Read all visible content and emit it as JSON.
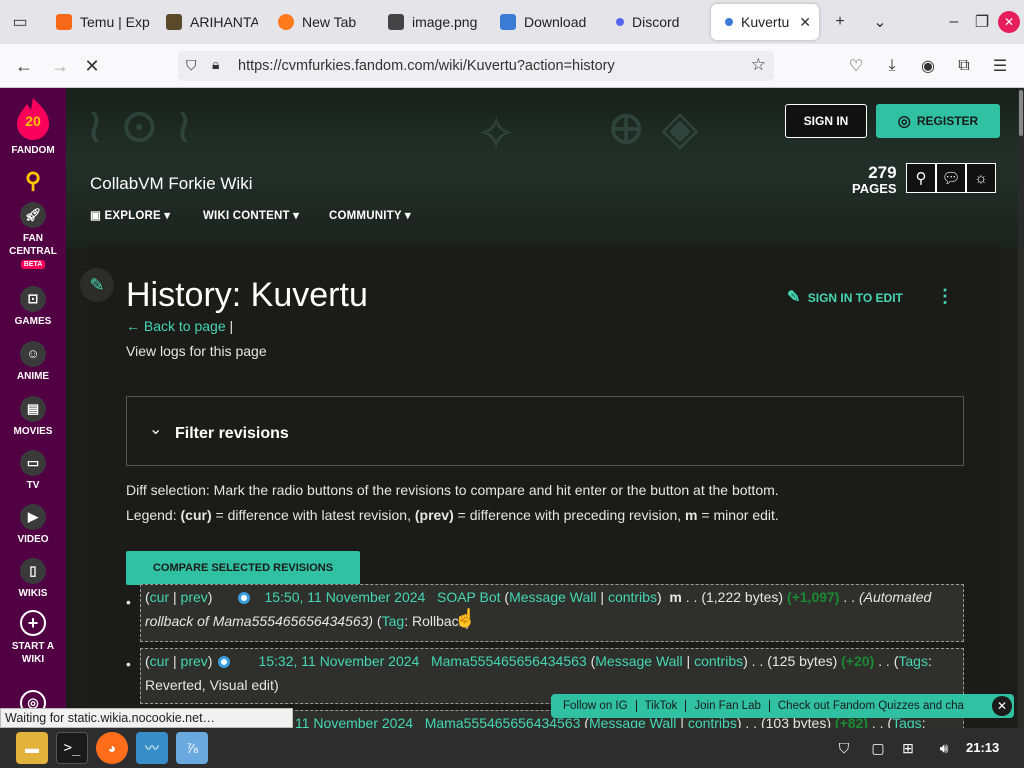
{
  "browser": {
    "tabs": [
      {
        "label": "Temu | Exp",
        "favicon": "#f86a1a"
      },
      {
        "label": "ARIHANTA",
        "favicon": "#5a4a2a"
      },
      {
        "label": "New Tab",
        "favicon": "#ff7a1a"
      },
      {
        "label": "image.png",
        "favicon": "#444444"
      },
      {
        "label": "Download",
        "favicon": "#3a7bd5"
      },
      {
        "label": "Discord",
        "favicon": "#5865f2"
      },
      {
        "label": "Kuvertu",
        "favicon": "#3a7bd5"
      }
    ],
    "url": "https://cvmfurkies.fandom.com/wiki/Kuvertu?action=history",
    "status_message": "Waiting for static.wikia.nocookie.net…"
  },
  "fandom_sidebar": {
    "logo_number": "20",
    "logo_label": "FANDOM",
    "items": [
      {
        "label": "FAN\nCENTRAL",
        "badge": "BETA"
      },
      {
        "label": "GAMES"
      },
      {
        "label": "ANIME"
      },
      {
        "label": "MOVIES"
      },
      {
        "label": "TV"
      },
      {
        "label": "VIDEO"
      },
      {
        "label": "WIKIS"
      },
      {
        "label": "START A\nWIKI"
      }
    ]
  },
  "header": {
    "wiki_name": "CollabVM Forkie Wiki",
    "sign_in": "SIGN IN",
    "register": "REGISTER",
    "page_count": "279",
    "page_label": "PAGES",
    "menu": [
      "EXPLORE",
      "WIKI CONTENT",
      "COMMUNITY"
    ]
  },
  "article": {
    "title": "History: Kuvertu",
    "sign_in_to_edit": "SIGN IN TO EDIT",
    "back_to_page": "Back to page",
    "view_logs": "View logs for this page",
    "filter_revisions": "Filter revisions",
    "diff_selection": "Diff selection: Mark the radio buttons of the revisions to compare and hit enter or the button at the bottom.",
    "legend_prefix": "Legend: ",
    "legend_cur": "(cur)",
    "legend_cur_desc": " = difference with latest revision, ",
    "legend_prev": "(prev)",
    "legend_prev_desc": " = difference with preceding revision, ",
    "legend_m": "m",
    "legend_m_desc": " = minor edit.",
    "compare_button": "COMPARE SELECTED REVISIONS",
    "revisions": [
      {
        "cur": "cur",
        "prev": "prev",
        "datetime": "15:50, 11 November 2024",
        "user": "SOAP Bot",
        "wall": "Message Wall",
        "contribs": "contribs",
        "minor": "m",
        "bytes": "(1,222 bytes)",
        "change": "(+1,097)",
        "summary": "(Automated rollback of Mama555465656434563)",
        "tag_label": "Tag",
        "tags": "Rollback"
      },
      {
        "cur": "cur",
        "prev": "prev",
        "datetime": "15:32, 11 November 2024",
        "user": "Mama555465656434563",
        "wall": "Message Wall",
        "contribs": "contribs",
        "minor": "",
        "bytes": "(125 bytes)",
        "change": "(+20)",
        "summary": "",
        "tag_label": "Tags",
        "tags": "Reverted, Visual edit"
      },
      {
        "cur": "",
        "prev": "",
        "datetime": "11 November 2024",
        "user": "Mama555465656434563",
        "wall": "Message Wall",
        "contribs": "contribs",
        "minor": "",
        "bytes": "(103 bytes)",
        "change": "(+82)",
        "summary": "",
        "tag_label": "Tags",
        "tags": ""
      }
    ]
  },
  "floatbar": {
    "items": [
      "Follow on IG",
      "TikTok",
      "Join Fan Lab",
      "Check out Fandom Quizzes and cha"
    ]
  },
  "taskbar": {
    "time": "21:13"
  },
  "colors": {
    "accent": "#2fc1a1",
    "link": "#45d7b5",
    "fandom_purple": "#520044",
    "fandom_logo": "#fa005a"
  }
}
